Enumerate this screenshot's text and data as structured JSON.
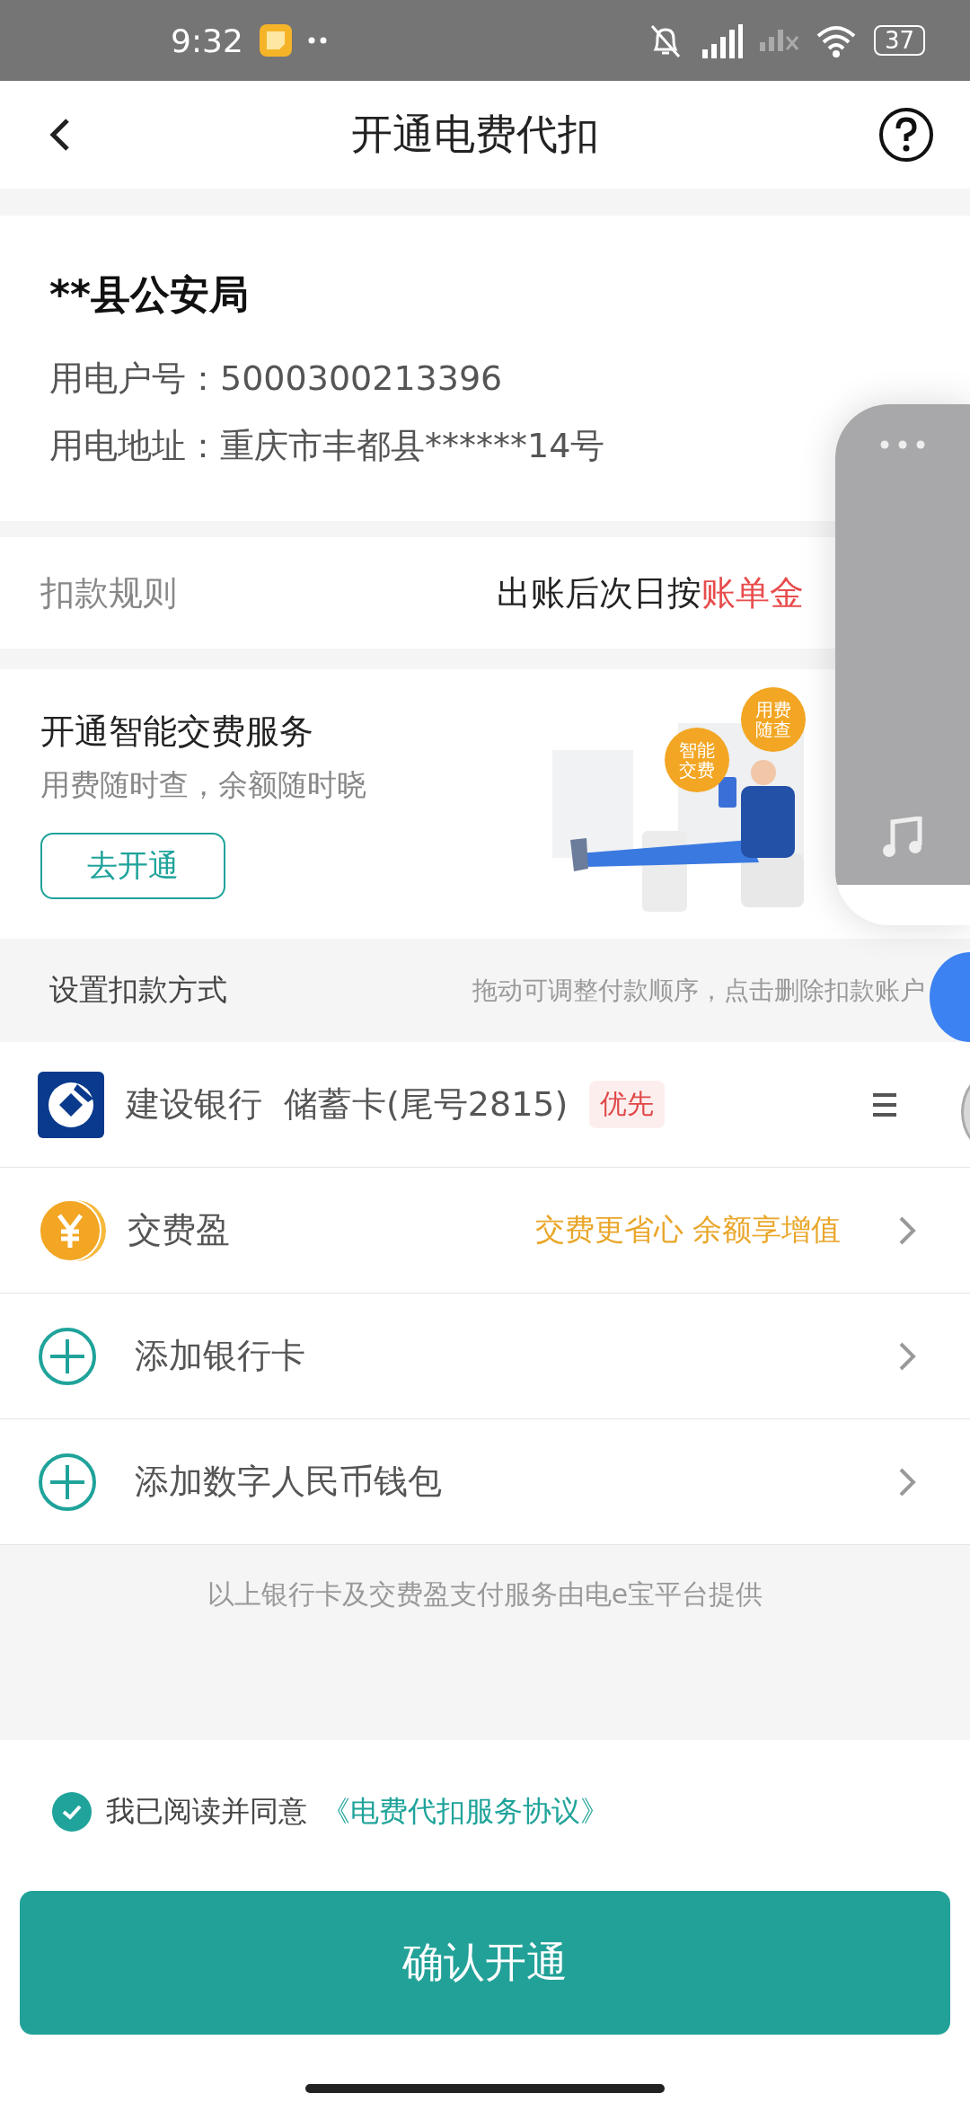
{
  "status_bar": {
    "time": "9:32",
    "battery": "37"
  },
  "header": {
    "title": "开通电费代扣"
  },
  "account": {
    "name": "**县公安局",
    "fields": [
      {
        "label": "用电户号：",
        "value": "5000300213396"
      },
      {
        "label": "用电地址：",
        "value": "重庆市丰都县******14号"
      }
    ]
  },
  "rule": {
    "label": "扣款规则",
    "value": "出账后次日按",
    "highlight": "账单金"
  },
  "promo": {
    "title": "开通智能交费服务",
    "subtitle": "用费随时查，余额随时晓",
    "button": "去开通",
    "bubbles": [
      "智能交费",
      "用费随查"
    ]
  },
  "payment": {
    "title": "设置扣款方式",
    "hint": "拖动可调整付款顺序，点击删除扣款账户",
    "methods": [
      {
        "kind": "bank",
        "name": "建设银行",
        "detail": "储蓄卡(尾号2815)",
        "tag": "优先"
      },
      {
        "kind": "wallet",
        "name": "交费盈",
        "promo": "交费更省心 余额享增值"
      },
      {
        "kind": "add",
        "name": "添加银行卡"
      },
      {
        "kind": "add",
        "name": "添加数字人民币钱包"
      }
    ],
    "note": "以上银行卡及交费盈支付服务由电e宝平台提供"
  },
  "agreement": {
    "checked": true,
    "text": "我已阅读并同意",
    "link": "《电费代扣服务协议》"
  },
  "confirm": "确认开通"
}
